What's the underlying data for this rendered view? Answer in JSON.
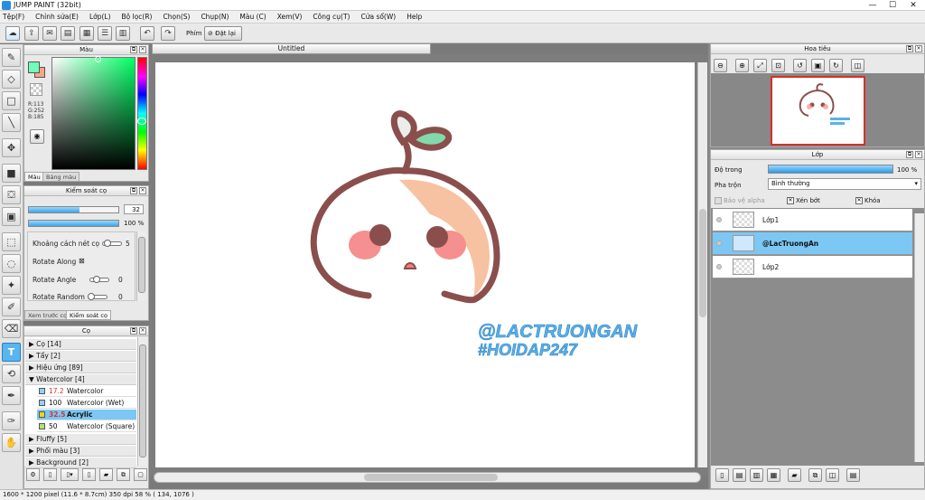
{
  "window": {
    "title": "JUMP PAINT (32bit)",
    "min": "—",
    "max": "☐",
    "close": "✕"
  },
  "menu": [
    "Tệp(F)",
    "Chỉnh sửa(E)",
    "Lớp(L)",
    "Bộ lọc(R)",
    "Chọn(S)",
    "Chụp(N)",
    "Màu (C)",
    "Xem(V)",
    "Công cụ(T)",
    "Cửa sổ(W)",
    "Help"
  ],
  "toolbar": {
    "shortcut_label": "Phím",
    "reset_label": "Đặt lại"
  },
  "color_panel": {
    "title": "Màu",
    "tabs": [
      "Màu",
      "Bảng màu"
    ],
    "r": "R:113",
    "g": "G:252",
    "b": "B:185",
    "fg": "#71fcb9",
    "bg": "#f9a48a"
  },
  "brush_control": {
    "title": "Kiểm soát cọ",
    "size": "32",
    "opacity": "100 %",
    "spacing_label": "Khoảng cách nét cọ",
    "spacing_value": "5",
    "rotate_along": "Rotate Along",
    "rotate_along_value": "⊠",
    "rotate_angle": "Rotate Angle",
    "rotate_angle_value": "0",
    "rotate_random": "Rotate Random",
    "rotate_random_value": "0",
    "tabs": [
      "Xem trước cọ",
      "Kiểm soát cọ"
    ]
  },
  "brush_list": {
    "title": "Cọ",
    "groups_top": [
      {
        "arrow": "▶",
        "label": "Cọ [14]"
      },
      {
        "arrow": "▶",
        "label": "Tẩy [2]"
      },
      {
        "arrow": "▶",
        "label": "Hiệu ứng [89]"
      },
      {
        "arrow": "▼",
        "label": "Watercolor [4]"
      }
    ],
    "items": [
      {
        "size": "17.2",
        "name": "Watercolor",
        "color": "#8fd3f4"
      },
      {
        "size": "100",
        "name": "Watercolor (Wet)",
        "color": "#8fd3f4"
      },
      {
        "size": "32.5",
        "name": "Acrylic",
        "color": "#f3d31a"
      },
      {
        "size": "50",
        "name": "Watercolor (Square)",
        "color": "#b5e26a"
      }
    ],
    "groups_bottom": [
      {
        "arrow": "▶",
        "label": "Fluffy [5]"
      },
      {
        "arrow": "▶",
        "label": "Phối màu [3]"
      },
      {
        "arrow": "▶",
        "label": "Background [2]"
      }
    ]
  },
  "document": {
    "tab": "Untitled",
    "watermark_line1": "@LACTRUONGAN",
    "watermark_line2": "#HOIDAP247"
  },
  "navigator": {
    "title": "Hoa tiêu"
  },
  "layers": {
    "title": "Lớp",
    "opacity_label": "Độ trong",
    "opacity_value": "100 %",
    "blend_label": "Pha trộn",
    "blend_value": "Bình thường",
    "protect_alpha": "Bảo vệ alpha",
    "clipping": "Xén bớt",
    "lock": "Khóa",
    "list": [
      {
        "name": "Lớp1",
        "selected": false
      },
      {
        "name": "@LacTruongAn",
        "selected": true
      },
      {
        "name": "Lớp2",
        "selected": false
      }
    ]
  },
  "status": {
    "text": "1600 * 1200 pixel   (11.6 * 8.7cm)   350 dpi   58 %   ( 134, 1076 )"
  }
}
